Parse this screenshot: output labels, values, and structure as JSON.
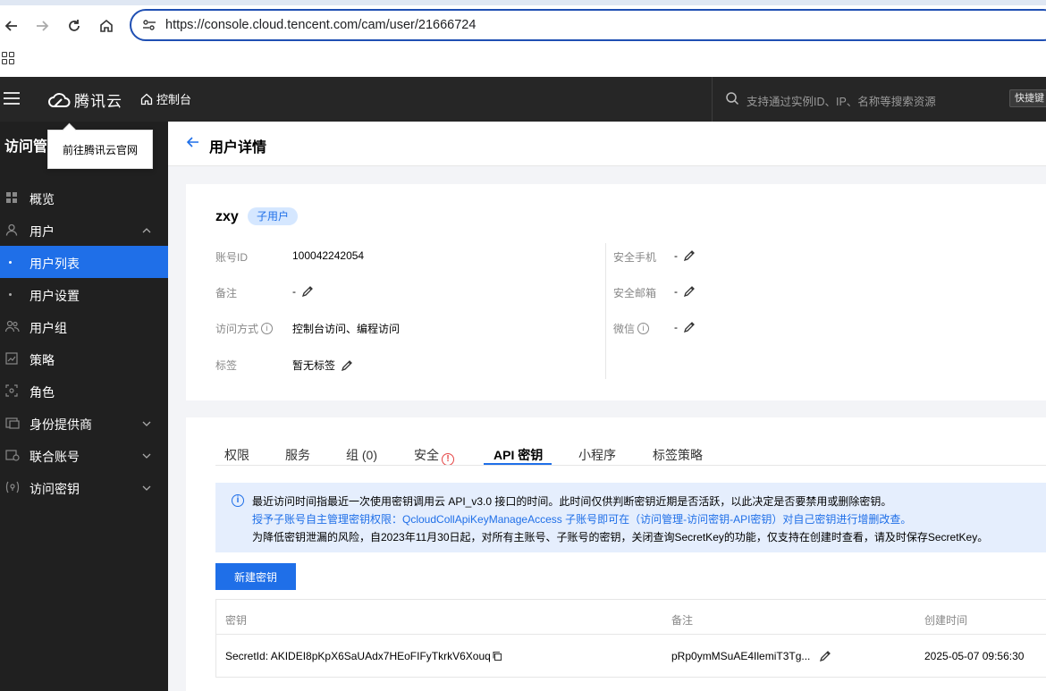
{
  "browser": {
    "url": "https://console.cloud.tencent.com/cam/user/21666724"
  },
  "topnav": {
    "brand": "腾讯云",
    "console_label": "控制台",
    "search_placeholder": "支持通过实例ID、IP、名称等搜索资源",
    "shortcut_label": "快捷键"
  },
  "sidebar": {
    "title": "访问管",
    "tooltip": "前往腾讯云官网",
    "items": [
      {
        "label": "概览"
      },
      {
        "label": "用户"
      },
      {
        "label": "用户列表"
      },
      {
        "label": "用户设置"
      },
      {
        "label": "用户组"
      },
      {
        "label": "策略"
      },
      {
        "label": "角色"
      },
      {
        "label": "身份提供商"
      },
      {
        "label": "联合账号"
      },
      {
        "label": "访问密钥"
      }
    ]
  },
  "page": {
    "title": "用户详情"
  },
  "user": {
    "name": "zxy",
    "role_badge": "子用户",
    "fields": {
      "account_id_label": "账号ID",
      "account_id_value": "100042242054",
      "remark_label": "备注",
      "remark_value": "-",
      "access_label": "访问方式",
      "access_value": "控制台访问、编程访问",
      "tag_label": "标签",
      "tag_value": "暂无标签",
      "phone_label": "安全手机",
      "phone_value": "-",
      "email_label": "安全邮箱",
      "email_value": "-",
      "wechat_label": "微信",
      "wechat_value": "-"
    }
  },
  "tabs": [
    {
      "label": "权限"
    },
    {
      "label": "服务"
    },
    {
      "label": "组 (0)"
    },
    {
      "label": "安全"
    },
    {
      "label": "API 密钥"
    },
    {
      "label": "小程序"
    },
    {
      "label": "标签策略"
    }
  ],
  "notice": {
    "line1": "最近访问时间指最近一次使用密钥调用云 API_v3.0 接口的时间。此时间仅供判断密钥近期是否活跃，以此决定是否要禁用或删除密钥。",
    "line2": "授予子账号自主管理密钥权限：QcloudCollApiKeyManageAccess 子账号即可在（访问管理-访问密钥-API密钥）对自己密钥进行增删改查。",
    "line3": "为降低密钥泄漏的风险，自2023年11月30日起，对所有主账号、子账号的密钥，关闭查询SecretKey的功能，仅支持在创建时查看，请及时保存SecretKey。"
  },
  "new_key_button": "新建密钥",
  "key_table": {
    "headers": [
      "密钥",
      "备注",
      "创建时间"
    ],
    "rows": [
      {
        "secret_id": "SecretId: AKIDEI8pKpX6SaUAdx7HEoFIFyTkrkV6Xouq",
        "remark": "pRp0ymMSuAE4IlemiT3Tg...",
        "created": "2025-05-07 09:56:30"
      }
    ]
  }
}
